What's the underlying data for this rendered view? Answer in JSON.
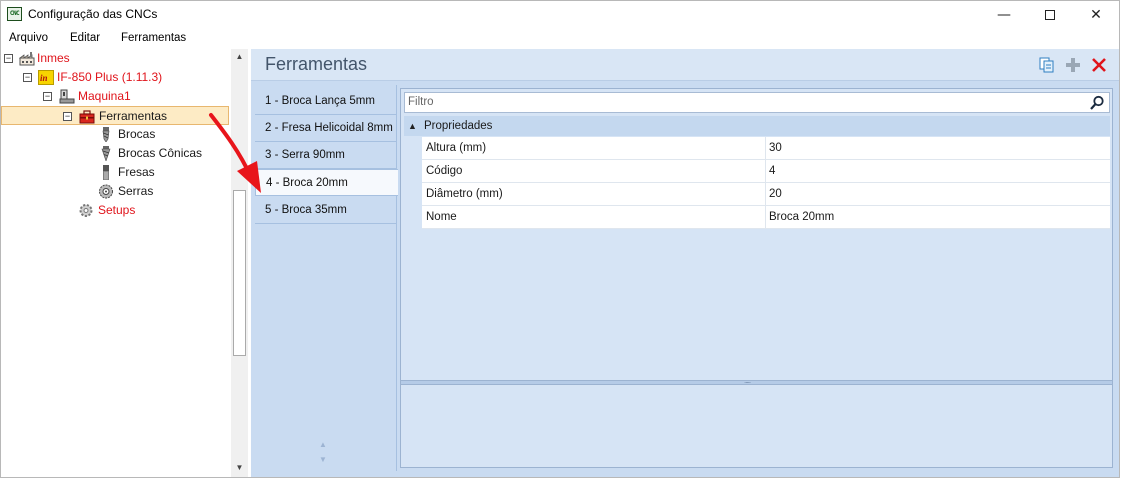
{
  "window": {
    "title": "Configuração das CNCs",
    "icon_text": "CNC",
    "controls": {
      "minimize": "—",
      "maximize": "",
      "close": "✕"
    }
  },
  "menu": {
    "items": [
      "Arquivo",
      "Editar",
      "Ferramentas"
    ]
  },
  "tree": {
    "items": [
      {
        "label": "Inmes",
        "level": 0,
        "expander": "⊟",
        "icon": "factory-icon",
        "color": "#e0141b"
      },
      {
        "label": "IF-850 Plus (1.11.3)",
        "level": 1,
        "expander": "⊟",
        "icon": "brand-logo-icon",
        "color": "#e0141b"
      },
      {
        "label": "Maquina1",
        "level": 2,
        "expander": "⊟",
        "icon": "machine-icon",
        "color": "#e0141b"
      },
      {
        "label": "Ferramentas",
        "level": 3,
        "expander": "⊟",
        "icon": "toolbox-icon",
        "color": "#1a1a1a",
        "selected": true
      },
      {
        "label": "Brocas",
        "level": 4,
        "icon": "drill-bit-icon",
        "color": "#1a1a1a"
      },
      {
        "label": "Brocas Cônicas",
        "level": 4,
        "icon": "conical-drill-icon",
        "color": "#1a1a1a"
      },
      {
        "label": "Fresas",
        "level": 4,
        "icon": "mill-icon",
        "color": "#1a1a1a"
      },
      {
        "label": "Serras",
        "level": 4,
        "icon": "saw-blade-icon",
        "color": "#1a1a1a"
      },
      {
        "label": "Setups",
        "level": 3,
        "icon": "gear-icon",
        "color": "#e0141b"
      }
    ]
  },
  "panel": {
    "title": "Ferramentas",
    "actions": [
      {
        "name": "copy-icon",
        "color": "#2f7fc1"
      },
      {
        "name": "add-icon",
        "color": "#9aa7b5"
      },
      {
        "name": "delete-icon",
        "color": "#e0141b"
      }
    ]
  },
  "tools": {
    "items": [
      "1 - Broca Lança 5mm",
      "2 - Fresa Helicoidal 8mm",
      "3 - Serra 90mm",
      "4 - Broca 20mm",
      "5 - Broca 35mm"
    ],
    "selected": "4 - Broca 20mm"
  },
  "properties": {
    "filter_placeholder": "Filtro",
    "category": "Propriedades",
    "rows": [
      {
        "name": "Altura (mm)",
        "value": "30"
      },
      {
        "name": "Código",
        "value": "4"
      },
      {
        "name": "Diâmetro (mm)",
        "value": "20"
      },
      {
        "name": "Nome",
        "value": "Broca 20mm"
      }
    ]
  },
  "colors": {
    "accent_red": "#e0141b",
    "panel_blue": "#c9dbf1",
    "selection": "#fdebc5"
  }
}
